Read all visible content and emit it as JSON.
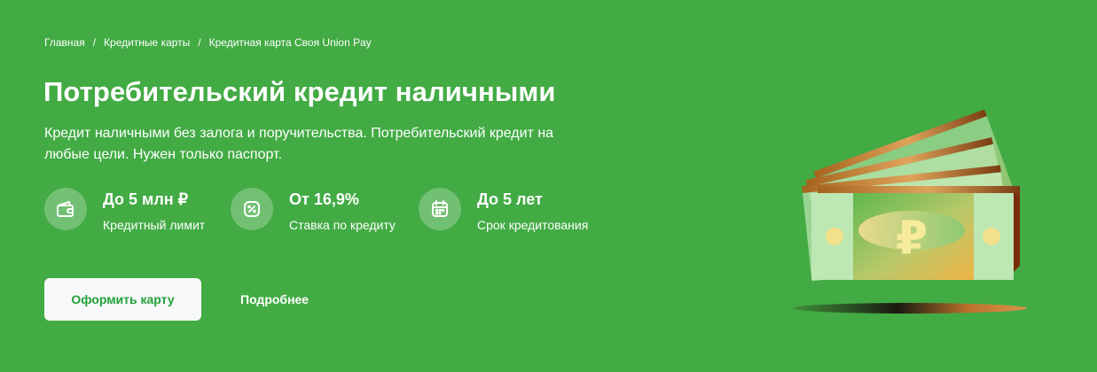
{
  "breadcrumb": [
    {
      "label": "Главная"
    },
    {
      "label": "Кредитные карты"
    },
    {
      "label": "Кредитная карта Своя Union Pay"
    }
  ],
  "breadcrumb_separator": "/",
  "title": "Потребительский кредит наличными",
  "subtitle": "Кредит наличными без залога и поручительства. Потребительский кредит на любые цели. Нужен только паспорт.",
  "features": [
    {
      "value": "До 5 млн ₽",
      "label": "Кредитный лимит",
      "icon": "wallet-icon"
    },
    {
      "value": "От 16,9%",
      "label": "Ставка по кредиту",
      "icon": "percent-icon"
    },
    {
      "value": "До 5 лет",
      "label": "Срок кредитования",
      "icon": "calendar-icon"
    }
  ],
  "actions": {
    "primary_label": "Оформить карту",
    "secondary_label": "Подробнее"
  },
  "illustration": {
    "symbol": "₽",
    "icon": "banknotes-illustration"
  },
  "colors": {
    "background": "#42ab44",
    "button_bg": "#f7f8f9",
    "button_text": "#21a038",
    "text": "#ffffff"
  }
}
